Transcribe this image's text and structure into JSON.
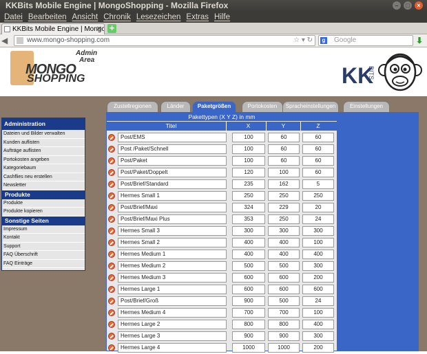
{
  "window": {
    "title": "KKBits Mobile Engine | MongoShopping - Mozilla Firefox"
  },
  "menu": [
    "Datei",
    "Bearbeiten",
    "Ansicht",
    "Chronik",
    "Lesezeichen",
    "Extras",
    "Hilfe"
  ],
  "browser": {
    "tab_title": "KKBits Mobile Engine | Mongo...",
    "url": "www.mongo-shopping.com",
    "search_placeholder": "Google"
  },
  "logo": {
    "admin": "Admin",
    "area": "Area",
    "mongo": "MONGO",
    "shopping": "SHOPPING",
    "kk": "KK",
    "bits": "BITS"
  },
  "admin_tabs": [
    {
      "label": "Zustellregionen",
      "active": false
    },
    {
      "label": "Länder",
      "active": false
    },
    {
      "label": "Paketgrößen",
      "active": true
    },
    {
      "label": "Portokosten",
      "active": false
    },
    {
      "label": "Spracheinstellungen",
      "active": false
    },
    {
      "label": "Einstellungen",
      "active": false
    }
  ],
  "sidebar": {
    "sections": [
      {
        "title": "Administration",
        "items": [
          "Dateien und Bilder verwalten",
          "Kunden auflisten",
          "Aufträge auflisten",
          "Portokosten angeben",
          "Kategoriebaum",
          "Cashflies neu erstellen",
          "Newsletter"
        ]
      },
      {
        "title": "Produkte",
        "items": [
          "Produkte",
          "Produkte kopieren"
        ]
      },
      {
        "title": "Sonstige Seiten",
        "items": [
          "Impressum",
          "Kontakt",
          "Support",
          "FAQ Überschrift",
          "FAQ Einträge"
        ]
      }
    ]
  },
  "table": {
    "title": "Pakettypen (X Y Z) in mm",
    "headers": [
      "Titel",
      "X",
      "Y",
      "Z"
    ],
    "rows": [
      [
        "Post/EMS",
        "100",
        "60",
        "60"
      ],
      [
        "Post /Paket/Schnell",
        "100",
        "60",
        "60"
      ],
      [
        "Post/Paket",
        "100",
        "60",
        "60"
      ],
      [
        "Post/Paket/Doppelt",
        "120",
        "100",
        "60"
      ],
      [
        "Post/Brief/Standard",
        "235",
        "162",
        "5"
      ],
      [
        "Hermes Small 1",
        "250",
        "250",
        "250"
      ],
      [
        "Post/Brief/Maxi",
        "324",
        "229",
        "20"
      ],
      [
        "Post/Brief/Maxi Plus",
        "353",
        "250",
        "24"
      ],
      [
        "Hermes Small 3",
        "300",
        "300",
        "300"
      ],
      [
        "Hermes Small 2",
        "400",
        "400",
        "100"
      ],
      [
        "Hermes Medium 1",
        "400",
        "400",
        "400"
      ],
      [
        "Hermes Medium 2",
        "500",
        "500",
        "300"
      ],
      [
        "Hermes Medium 3",
        "600",
        "600",
        "200"
      ],
      [
        "Hermes Large 1",
        "600",
        "600",
        "600"
      ],
      [
        "Post/Brief/Groß",
        "900",
        "500",
        "24"
      ],
      [
        "Hermes Medium 4",
        "700",
        "700",
        "100"
      ],
      [
        "Hermes Large 2",
        "800",
        "800",
        "400"
      ],
      [
        "Hermes Large 3",
        "900",
        "900",
        "300"
      ],
      [
        "Hermes Large 4",
        "1000",
        "1000",
        "200"
      ]
    ]
  }
}
